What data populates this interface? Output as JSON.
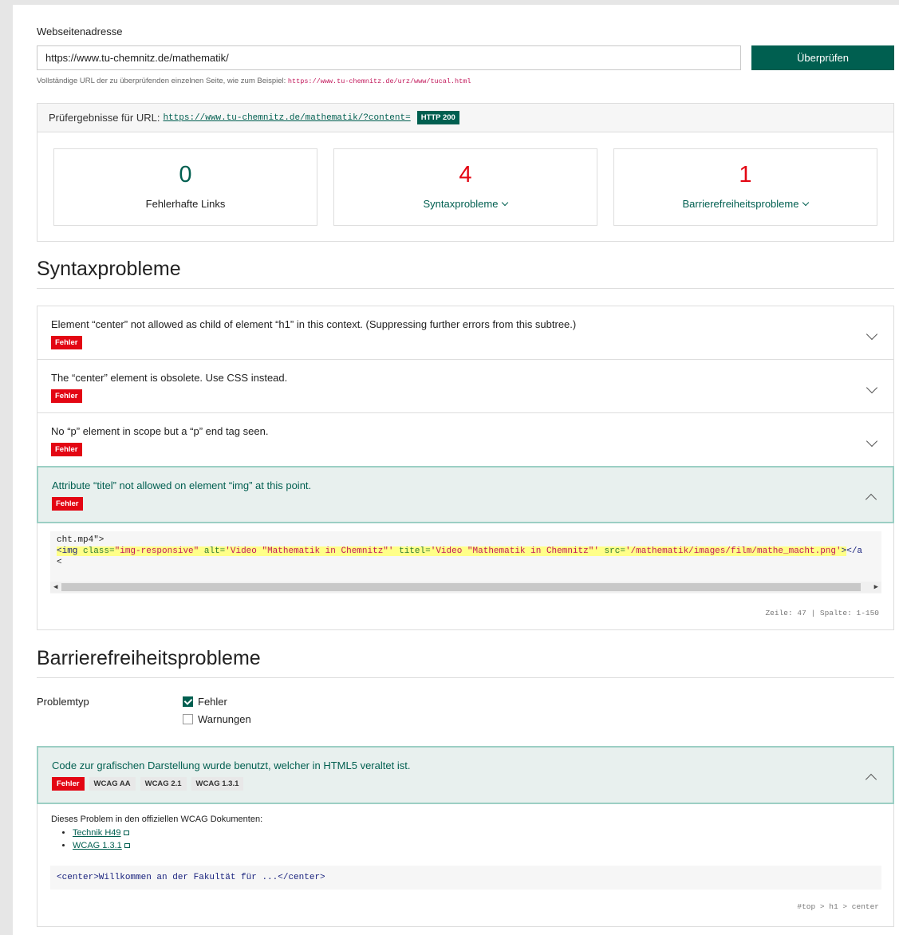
{
  "form": {
    "label": "Webseitenadresse",
    "url_value": "https://www.tu-chemnitz.de/mathematik/",
    "submit_label": "Überprüfen",
    "help_text": "Vollständige URL der zu überprüfenden einzelnen Seite, wie zum Beispiel:",
    "help_example": "https://www.tu-chemnitz.de/urz/www/tucal.html"
  },
  "results": {
    "prefix": "Prüfergebnisse für URL:",
    "url": "https://www.tu-chemnitz.de/mathematik/?content=",
    "http_status": "HTTP 200",
    "stats": [
      {
        "value": "0",
        "label": "Fehlerhafte Links",
        "color": "#005f50"
      },
      {
        "value": "4",
        "label": "Syntaxprobleme",
        "color": "#e30613"
      },
      {
        "value": "1",
        "label": "Barrierefreiheitsprobleme",
        "color": "#e30613"
      }
    ]
  },
  "syntax": {
    "heading": "Syntaxprobleme",
    "items": [
      {
        "message": "Element “center” not allowed as child of element “h1” in this context. (Suppressing further errors from this subtree.)",
        "badge": "Fehler"
      },
      {
        "message": "The “center” element is obsolete. Use CSS instead.",
        "badge": "Fehler"
      },
      {
        "message": "No “p” element in scope but a “p” end tag seen.",
        "badge": "Fehler"
      },
      {
        "message": "Attribute “titel” not allowed on element “img” at this point.",
        "badge": "Fehler"
      }
    ],
    "code": {
      "line1": "cht.mp4\">",
      "line3": "<",
      "tag_open": "<img",
      "attr1_name": " class=",
      "attr1_value": "\"img-responsive\"",
      "attr2_name": " alt=",
      "attr2_value": "'Video \"Mathematik in Chemnitz\"'",
      "attr3_name": " titel=",
      "attr3_value": "'Video \"Mathematik in Chemnitz\"'",
      "attr4_name": " src=",
      "attr4_value": "'/mathematik/images/film/mathe_macht.png'",
      "tag_close": ">",
      "tail": "</a",
      "position": "Zeile: 47 | Spalte: 1-150"
    }
  },
  "a11y": {
    "heading": "Barrierefreiheitsprobleme",
    "filter_label": "Problemtyp",
    "filters": [
      {
        "label": "Fehler",
        "checked": true
      },
      {
        "label": "Warnungen",
        "checked": false
      }
    ],
    "item": {
      "message": "Code zur grafischen Darstellung wurde benutzt, welcher in HTML5 veraltet ist.",
      "badges": [
        "Fehler",
        "WCAG AA",
        "WCAG 2.1",
        "WCAG 1.3.1"
      ],
      "intro": "Dieses Problem in den offiziellen WCAG Dokumenten:",
      "links": [
        "Technik H49",
        "WCAG 1.3.1"
      ],
      "snippet": "<center>Willkommen an der Fakultät für ...</center>",
      "selector": "#top > h1 > center"
    }
  }
}
